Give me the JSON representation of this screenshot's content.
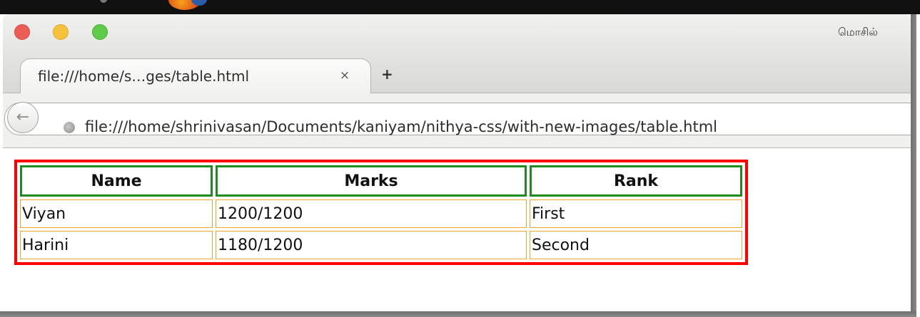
{
  "browser": {
    "window_title": "மொசில்",
    "tab": {
      "title": "file:///home/s…ges/table.html",
      "close_glyph": "×"
    },
    "new_tab_glyph": "+",
    "url": "file:///home/shrinivasan/Documents/kaniyam/nithya-css/with-new-images/table.html",
    "icons": {
      "back": "back-arrow-icon",
      "site": "globe-icon",
      "window_controls": [
        "close-icon",
        "minimize-icon",
        "maximize-icon"
      ]
    },
    "colors": {
      "close": "#ec5e55",
      "minimize": "#f6c23c",
      "maximize": "#5fcb4a"
    }
  },
  "table": {
    "headers": [
      "Name",
      "Marks",
      "Rank"
    ],
    "rows": [
      [
        "Viyan",
        "1200/1200",
        "First"
      ],
      [
        "Harini",
        "1180/1200",
        "Second"
      ]
    ],
    "colors": {
      "outer_border": "#ff0000",
      "header_border": "#1f8a1f",
      "cell_border": "#f0a62a"
    }
  }
}
